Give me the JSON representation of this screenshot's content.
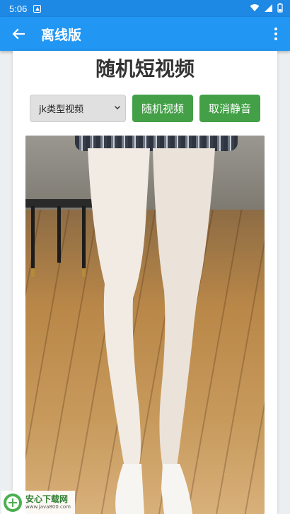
{
  "status_bar": {
    "time": "5:06"
  },
  "app_bar": {
    "title": "离线版"
  },
  "page": {
    "heading": "随机短视频"
  },
  "controls": {
    "category_select": {
      "selected": "jk类型视频"
    },
    "random_button": "随机视频",
    "unmute_button": "取消静音"
  },
  "watermark": {
    "name": "安心下载网",
    "url": "www.java800.com",
    "badge": "安心"
  },
  "colors": {
    "app_bar": "#2196f3",
    "status_bar": "#1e88e5",
    "button": "#43a047"
  }
}
